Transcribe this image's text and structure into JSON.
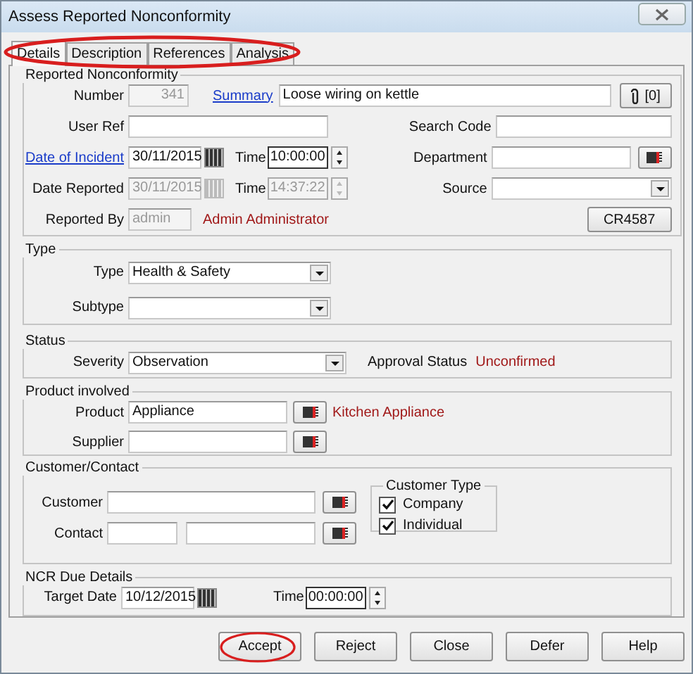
{
  "window": {
    "title": "Assess Reported Nonconformity"
  },
  "tabs": [
    {
      "label": "Details",
      "selected": true
    },
    {
      "label": "Description",
      "selected": false
    },
    {
      "label": "References",
      "selected": false
    },
    {
      "label": "Analysis",
      "selected": false
    }
  ],
  "reported": {
    "title": "Reported Nonconformity",
    "number": {
      "label": "Number",
      "value": "341",
      "disabled": true
    },
    "summary": {
      "label": "Summary",
      "value": "Loose wiring on kettle"
    },
    "attachments": "[0]",
    "user_ref": {
      "label": "User Ref"
    },
    "search_code": {
      "label": "Search Code"
    },
    "date_of_incident": {
      "label": "Date of Incident",
      "value": "30/11/2015",
      "disabled": false
    },
    "incident_time": {
      "label": "Time",
      "value": "10:00:00",
      "disabled": false
    },
    "department": {
      "label": "Department"
    },
    "date_reported": {
      "label": "Date Reported",
      "value": "30/11/2015",
      "disabled": true
    },
    "reported_time": {
      "label": "Time",
      "value": "14:37:22",
      "disabled": true
    },
    "source": {
      "label": "Source"
    },
    "reported_by": {
      "label": "Reported By",
      "value": "admin",
      "disabled": true,
      "name": "Admin Administrator"
    },
    "reference_button": "CR4587"
  },
  "type": {
    "title": "Type",
    "type": {
      "label": "Type",
      "value": "Health & Safety"
    },
    "subtype": {
      "label": "Subtype"
    }
  },
  "status": {
    "title": "Status",
    "severity": {
      "label": "Severity",
      "value": "Observation"
    },
    "approval_label": "Approval Status",
    "approval_value": "Unconfirmed"
  },
  "product": {
    "title": "Product involved",
    "product": {
      "label": "Product",
      "value": "Appliance",
      "description": "Kitchen Appliance"
    },
    "supplier": {
      "label": "Supplier"
    }
  },
  "customer": {
    "title": "Customer/Contact",
    "customer": {
      "label": "Customer"
    },
    "contact": {
      "label": "Contact"
    },
    "customer_type": {
      "title": "Customer Type",
      "options": [
        {
          "label": "Company",
          "checked": true
        },
        {
          "label": "Individual",
          "checked": true
        }
      ]
    }
  },
  "due": {
    "title": "NCR Due Details",
    "target_date": {
      "label": "Target Date",
      "value": "10/12/2015"
    },
    "time": {
      "label": "Time",
      "value": "00:00:00"
    }
  },
  "buttons": [
    "Accept",
    "Reject",
    "Close",
    "Defer",
    "Help"
  ]
}
